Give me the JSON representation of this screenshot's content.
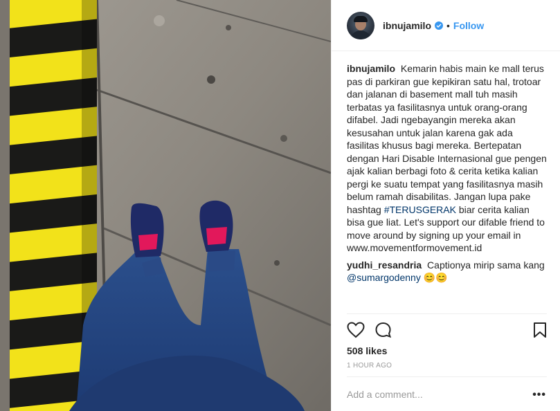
{
  "header": {
    "username": "ibnujamilo",
    "separator": "•",
    "follow_label": "Follow"
  },
  "caption": {
    "username": "ibnujamilo",
    "text_before": "Kemarin habis main ke mall terus pas di parkiran gue kepikiran satu hal, trotoar dan jalanan di basement mall tuh masih terbatas ya fasilitasnya untuk orang-orang difabel. Jadi ngebayangin mereka akan kesusahan untuk jalan karena gak ada fasilitas khusus bagi mereka. Bertepatan dengan Hari Disable Internasional gue pengen ajak kalian berbagi foto & cerita ketika kalian pergi ke suatu tempat yang fasilitasnya masih belum ramah disabilitas. Jangan lupa pake hashtag",
    "hashtag": "#TERUSGERAK",
    "text_after": "biar cerita kalian bisa gue liat. Let's support our difable friend to move around by signing up your email in www.movementformovement.id"
  },
  "comment": {
    "username": "yudhi_resandria",
    "text": "Captionya mirip sama kang",
    "mention": "@sumargodenny",
    "emoji": "😊😊"
  },
  "actions": {
    "like_icon": "heart-icon",
    "comment_icon": "comment-bubble-icon",
    "save_icon": "bookmark-icon"
  },
  "likes": "508 likes",
  "timestamp": "1 HOUR AGO",
  "add_comment": {
    "placeholder": "Add a comment...",
    "more_label": "•••"
  },
  "colors": {
    "accent": "#3897f0",
    "link": "#003569",
    "muted": "#999999",
    "text": "#262626"
  }
}
